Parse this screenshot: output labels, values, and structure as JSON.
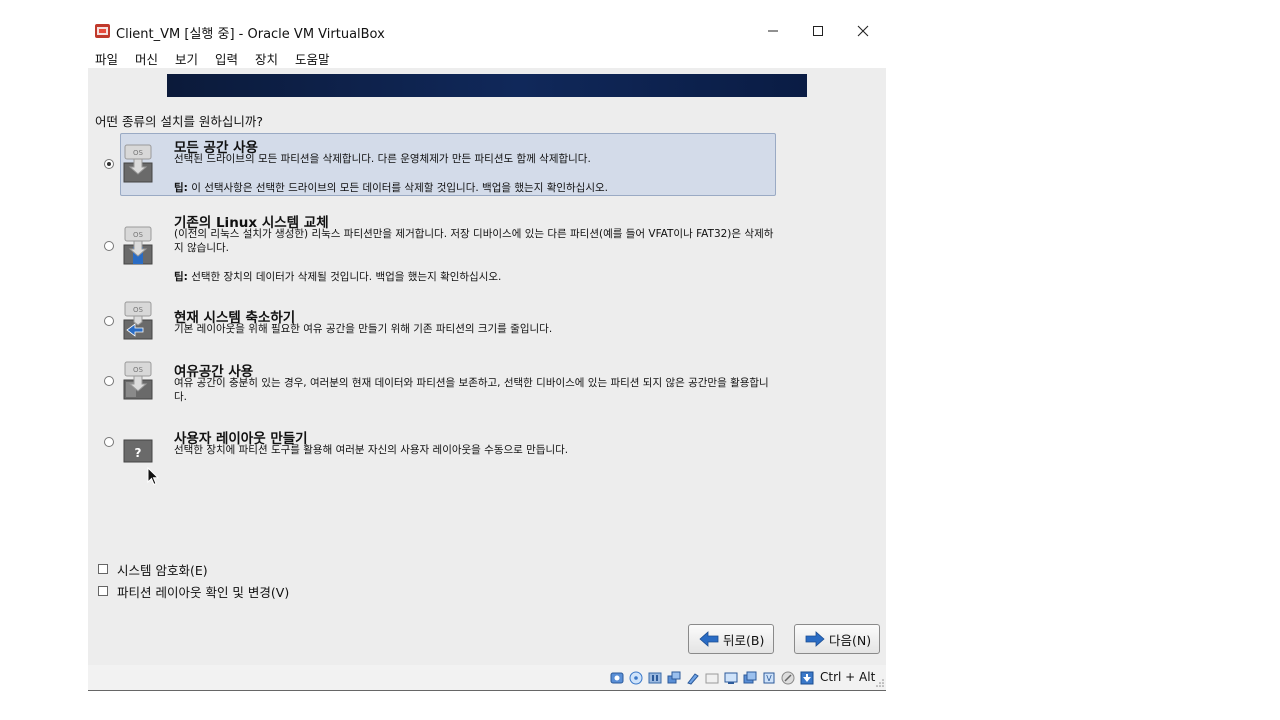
{
  "window": {
    "title": "Client_VM [실행 중] - Oracle VM VirtualBox"
  },
  "menu": [
    "파일",
    "머신",
    "보기",
    "입력",
    "장치",
    "도움말"
  ],
  "installer": {
    "question": "어떤 종류의 설치를 원하십니까?",
    "options": [
      {
        "title": "모든 공간 사용",
        "desc": "선택된 드라이브의 모든 파티션을 삭제합니다. 다른 운영체제가 만든 파티션도 함께 삭제합니다.",
        "tip_label": "팁:",
        "tip": " 이 선택사항은 선택한 드라이브의 모든 데이터를 삭제할 것입니다. 백업을 했는지 확인하십시오.",
        "selected": true,
        "icon": "disk-full-icon"
      },
      {
        "title": "기존의 Linux 시스템 교체",
        "desc": "(이전의 리눅스 설치가 생성한) 리눅스 파티션만을 제거합니다. 저장 디바이스에 있는 다른 파티션(예를 들어 VFAT이나 FAT32)은 삭제하지 않습니다.",
        "tip_label": "팁:",
        "tip": " 선택한 장치의 데이터가 삭제될 것입니다. 백업을 했는지 확인하십시오.",
        "selected": false,
        "icon": "disk-replace-icon"
      },
      {
        "title": "현재 시스템 축소하기",
        "desc": "기본 레이아웃을 위해 필요한 여유 공간을 만들기 위해 기존 파티션의 크기를 줄입니다.",
        "selected": false,
        "icon": "disk-shrink-icon"
      },
      {
        "title": "여유공간 사용",
        "desc": "여유 공간이 충분히 있는 경우, 여러분의 현재 데이터와 파티션을 보존하고, 선택한 디바이스에 있는 파티션 되지 않은 공간만을 활용합니다.",
        "selected": false,
        "icon": "disk-free-space-icon"
      },
      {
        "title": "사용자 레이아웃 만들기",
        "desc": "선택한 장치에 파티션 도구를 활용해 여러분 자신의 사용자 레이아웃을 수동으로 만듭니다.",
        "selected": false,
        "icon": "disk-custom-icon"
      }
    ],
    "checkboxes": [
      {
        "label": "시스템 암호화(E)",
        "checked": false
      },
      {
        "label": "파티션 레이아웃 확인 및 변경(V)",
        "checked": false
      }
    ],
    "back_label": "뒤로(B)",
    "next_label": "다음(N)"
  },
  "statusbar": {
    "host_key": "Ctrl + Alt"
  },
  "colors": {
    "banner": "#10285a",
    "selected_bg": "#d3dbe9",
    "arrow_blue": "#2a6cc4"
  }
}
